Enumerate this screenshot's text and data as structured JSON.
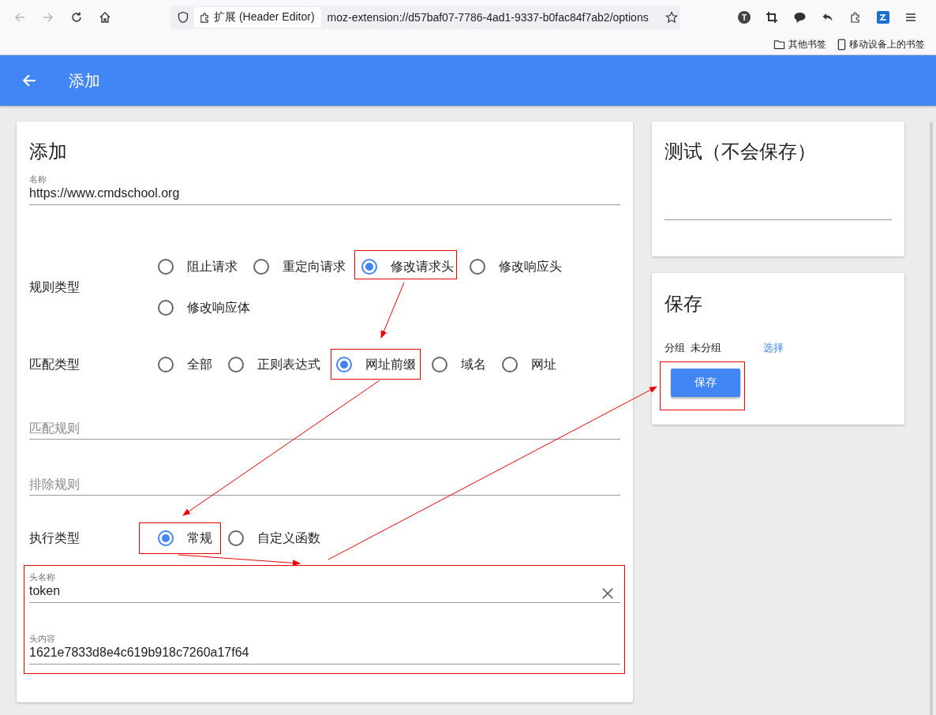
{
  "browser": {
    "identity_label": "扩展 (Header Editor)",
    "url": "moz-extension://d57baf07-7786-4ad1-9337-b0fac84f7ab2/options",
    "account_initial": "T",
    "bookmarks": [
      "其他书签",
      "移动设备上的书签"
    ]
  },
  "app_bar": {
    "title": "添加"
  },
  "editor": {
    "title": "添加",
    "name_field": {
      "label": "名称",
      "value": "https://www.cmdschool.org"
    },
    "rule_type": {
      "label": "规则类型",
      "options": [
        {
          "label": "阻止请求",
          "selected": false
        },
        {
          "label": "重定向请求",
          "selected": false
        },
        {
          "label": "修改请求头",
          "selected": true
        },
        {
          "label": "修改响应头",
          "selected": false
        },
        {
          "label": "修改响应体",
          "selected": false
        }
      ]
    },
    "match_type": {
      "label": "匹配类型",
      "options": [
        {
          "label": "全部",
          "selected": false
        },
        {
          "label": "正则表达式",
          "selected": false
        },
        {
          "label": "网址前缀",
          "selected": true
        },
        {
          "label": "域名",
          "selected": false
        },
        {
          "label": "网址",
          "selected": false
        }
      ]
    },
    "match_rule": {
      "placeholder": "匹配规则"
    },
    "exclude_rule": {
      "placeholder": "排除规则"
    },
    "exec_type": {
      "label": "执行类型",
      "options": [
        {
          "label": "常规",
          "selected": true
        },
        {
          "label": "自定义函数",
          "selected": false
        }
      ]
    },
    "header_name": {
      "label": "头名称",
      "value": "token"
    },
    "header_value": {
      "label": "头内容",
      "value": "1621e7833d8e4c619b918c7260a17f64"
    }
  },
  "test_card": {
    "title": "测试（不会保存）"
  },
  "save_card": {
    "title": "保存",
    "group_label": "分组",
    "group_value": "未分组",
    "select_link": "选择",
    "save_button": "保存"
  }
}
